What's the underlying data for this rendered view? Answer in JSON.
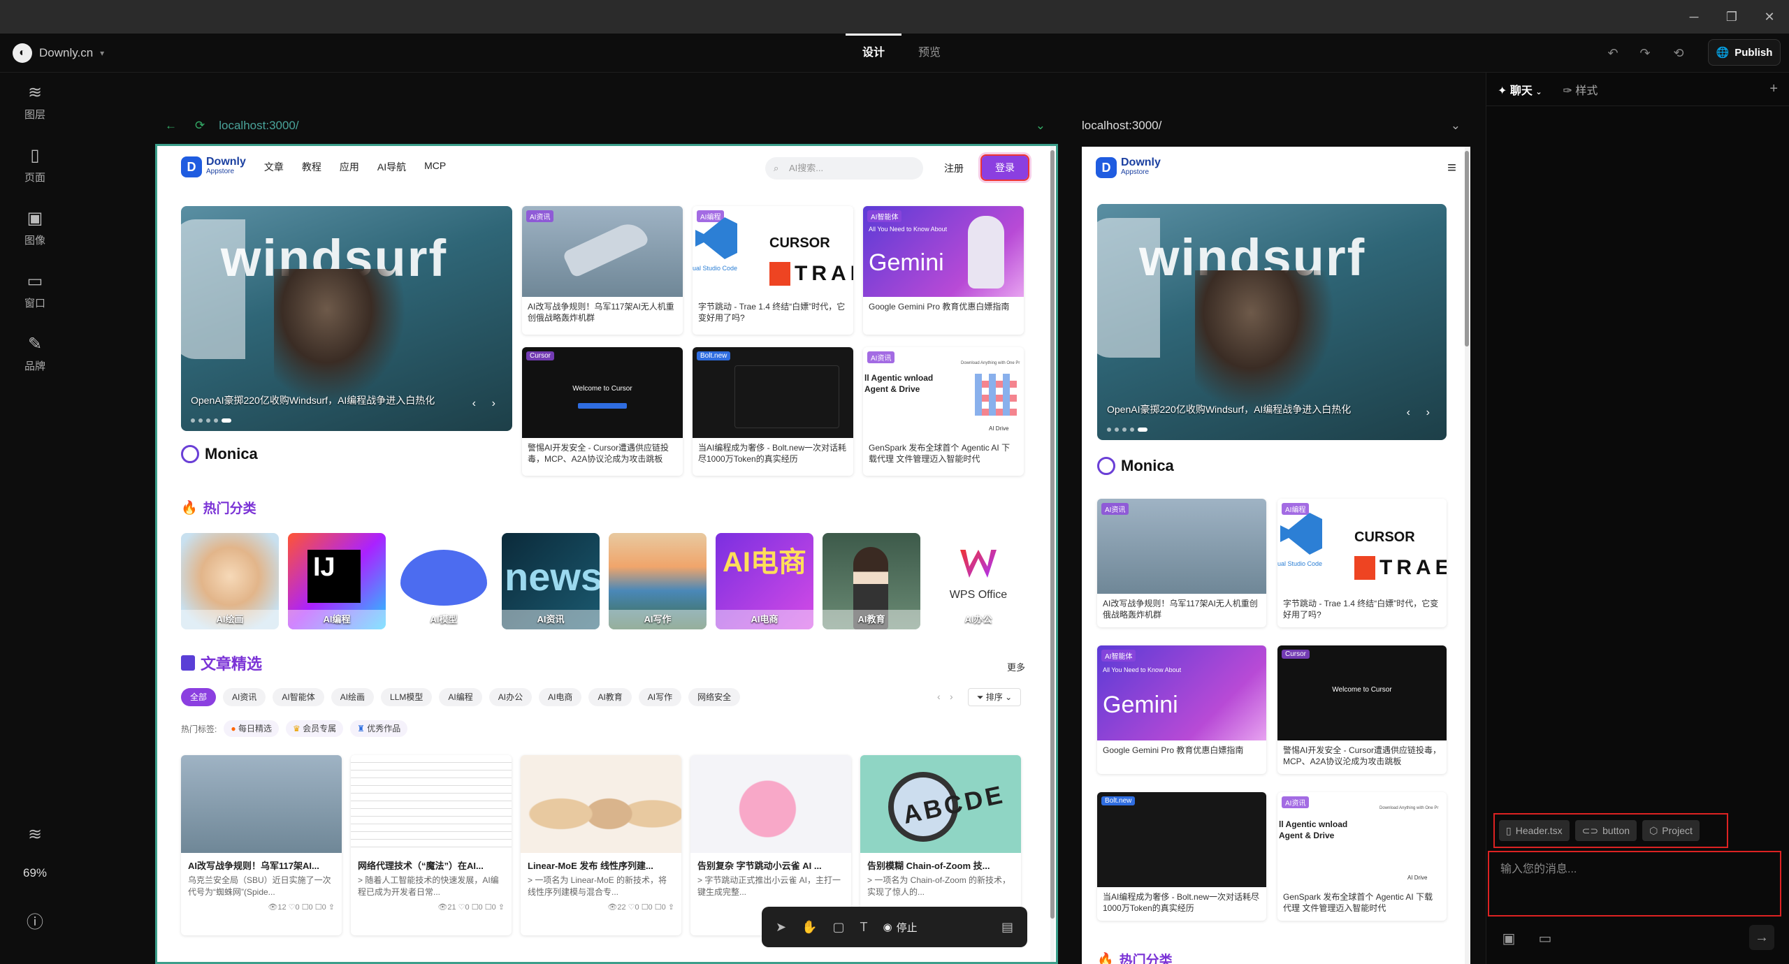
{
  "app": {
    "workspace": "Downly.cn",
    "modes": [
      "设计",
      "预览"
    ],
    "active_mode": "设计",
    "publish_label": "Publish",
    "zoom": "69%"
  },
  "leftnav": [
    {
      "label": "图层",
      "icon": "layers-icon"
    },
    {
      "label": "页面",
      "icon": "page-icon"
    },
    {
      "label": "图像",
      "icon": "image-icon"
    },
    {
      "label": "窗口",
      "icon": "window-icon"
    },
    {
      "label": "品牌",
      "icon": "brand-icon"
    }
  ],
  "preview": {
    "url_main": "localhost:3000/",
    "url_mobile": "localhost:3000/"
  },
  "site": {
    "logo_name": "Downly",
    "logo_sub": "Appstore",
    "nav": [
      "文章",
      "教程",
      "应用",
      "AI导航",
      "MCP"
    ],
    "search_placeholder": "AI搜索...",
    "register": "注册",
    "login": "登录",
    "hero_caption": "OpenAI豪掷220亿收购Windsurf，AI编程战争进入白热化",
    "hero_wordmark": "windsurf",
    "monica": "Monica",
    "cards": [
      {
        "title": "AI改写战争规则！乌军117架AI无人机重创俄战略轰炸机群",
        "tag": "AI资讯"
      },
      {
        "title": "字节跳动 - Trae 1.4 终结“白嫖”时代，它变好用了吗?",
        "tag": "AI编程"
      },
      {
        "title": "Google Gemini Pro 教育优惠白嫖指南",
        "tag": "AI智能体"
      },
      {
        "title": "警惕AI开发安全 - Cursor遭遇供应链投毒，MCP、A2A协议沦成为攻击跳板",
        "tag": "Cursor"
      },
      {
        "title": "当AI编程成为奢侈 - Bolt.new一次对话耗尽1000万Token的真实经历",
        "tag": "Bolt.new"
      },
      {
        "title": "GenSpark 发布全球首个 Agentic AI 下载代理 文件管理迈入智能时代",
        "tag": "AI资讯"
      }
    ],
    "card_art": {
      "cursor": "CURSOR",
      "trae": "TRAE",
      "gemini": "Gemini",
      "gemini_sub": "All You Need to Know About",
      "welcome": "Welcome to Cursor",
      "agentic": "ll Agentic wnload Agent & Drive",
      "studio": "ual Studio Code",
      "ai_drive": "AI Drive",
      "genspark": "Download Anything with One Pr"
    },
    "hot_title": "热门分类",
    "categories": [
      "AI绘画",
      "AI编程",
      "AI模型",
      "AI资讯",
      "AI写作",
      "AI电商",
      "AI教育",
      "AI办公"
    ],
    "cat_art": {
      "ij": "IJ",
      "news": "news",
      "ecom": "AI电商",
      "wps": "WPS Office"
    },
    "articles_title": "文章精选",
    "more": "更多",
    "filters": [
      "全部",
      "AI资讯",
      "AI智能体",
      "AI绘画",
      "LLM模型",
      "AI编程",
      "AI办公",
      "AI电商",
      "AI教育",
      "AI写作",
      "网络安全"
    ],
    "sort": "排序",
    "hot_tags_label": "热门标签:",
    "hot_tags": [
      "每日精选",
      "会员专属",
      "优秀作品"
    ],
    "articles": [
      {
        "title": "AI改写战争规则！乌军117架AI...",
        "desc": "乌克兰安全局（SBU）近日实施了一次代号为“蜘蛛网”(Spide...",
        "meta": "👁12 ♡0 ☐0 ☐0 ⇪"
      },
      {
        "title": "网络代理技术（“魔法”）在AI...",
        "desc": "> 随着人工智能技术的快速发展，AI编程已成为开发者日常...",
        "meta": "👁21 ♡0 ☐0 ☐0 ⇪"
      },
      {
        "title": "Linear-MoE 发布 线性序列建...",
        "desc": "> 一项名为 Linear-MoE 的新技术，将线性序列建模与混合专...",
        "meta": "👁22 ♡0 ☐0 ☐0 ⇪"
      },
      {
        "title": "告别复杂 字节跳动小云雀 AI ...",
        "desc": "> 字节跳动正式推出小云雀 AI，主打一键生成完整...",
        "meta": ""
      },
      {
        "title": "告别模糊 Chain-of-Zoom 技...",
        "desc": "> 一项名为 Chain-of-Zoom 的新技术，实现了惊人的...",
        "meta": ""
      }
    ],
    "abcde": "ABCDE",
    "mobile_hot_partial": "热门分类"
  },
  "toolbar": {
    "stop_label": "停止"
  },
  "chat": {
    "tab_chat": "聊天",
    "tab_style": "样式",
    "context": [
      "Header.tsx",
      "button",
      "Project"
    ],
    "input_placeholder": "输入您的消息..."
  }
}
